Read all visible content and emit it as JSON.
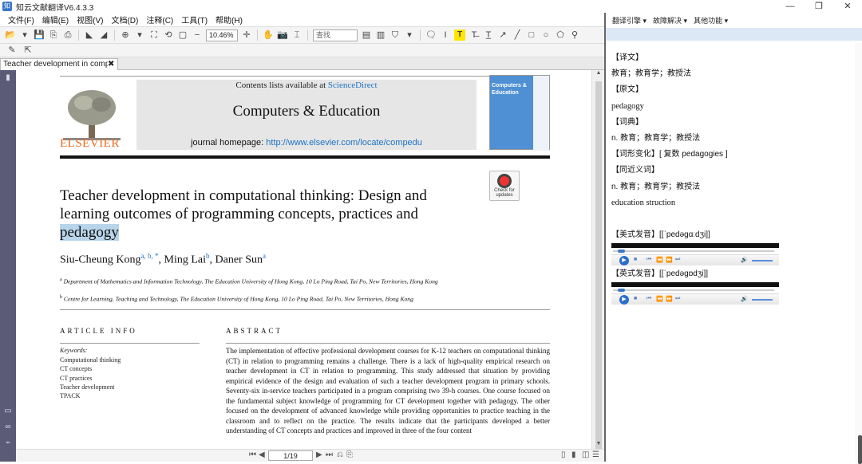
{
  "window": {
    "title": "知云文献翻译V6.4.3.3",
    "controls": [
      "—",
      "❐",
      "✕"
    ]
  },
  "menu": [
    "文件(F)",
    "编辑(E)",
    "视图(V)",
    "文档(D)",
    "注释(C)",
    "工具(T)",
    "帮助(H)"
  ],
  "toolbar": {
    "zoom_value": "10.46%",
    "find_placeholder": "查找"
  },
  "tab": {
    "label": "Teacher development in comp...",
    "close": "✖"
  },
  "doc": {
    "available": "Contents lists available at ",
    "sciencedirect": "ScienceDirect",
    "journal": "Computers & Education",
    "homepage_label": "journal homepage: ",
    "homepage_url": "http://www.elsevier.com/locate/compedu",
    "publisher": "ELSEVIER",
    "cover_title": "Computers & Education",
    "check_updates": "Check for updates",
    "title_part1": "Teacher development in computational thinking: Design and learning outcomes of programming concepts, practices and ",
    "title_highlight": "pedagogy",
    "author1": "Siu-Cheung Kong",
    "author1_sup": "a, b, *",
    "author2": ", Ming Lai",
    "author2_sup": "b",
    "author3": ", Daner Sun",
    "author3_sup": "a",
    "affil_a_sup": "a",
    "affil_a": "Department of Mathematics and Information Technology, The Education University of Hong Kong, 10 Lo Ping Road, Tai Po, New Territories, Hong Kong",
    "affil_b_sup": "b",
    "affil_b": "Centre for Learning, Teaching and Technology, The Education University of Hong Kong, 10 Lo Ping Road, Tai Po, New Territories, Hong Kong",
    "article_info_head": "ARTICLE INFO",
    "abstract_head": "ABSTRACT",
    "keywords_label": "Keywords:",
    "keywords": [
      "Computational thinking",
      "CT concepts",
      "CT practices",
      "Teacher development",
      "TPACK"
    ],
    "abstract": "The implementation of effective professional development courses for K-12 teachers on computational thinking (CT) in relation to programming remains a challenge. There is a lack of high-quality empirical research on teacher development in CT in relation to programming. This study addressed that situation by providing empirical evidence of the design and evaluation of such a teacher development program in primary schools. Seventy-six in-service teachers participated in a program comprising two 39-h courses. One course focused on the fundamental subject knowledge of programming for CT development together with pedagogy. The other focused on the development of advanced knowledge while providing opportunities to practice teaching in the classroom and to reflect on the practice. The results indicate that the participants developed a better understanding of CT concepts and practices and improved in three of the four content"
  },
  "pagination": {
    "current": "1/19"
  },
  "right_panel": {
    "menus": [
      "翻译引擎 ▾",
      "故障解决 ▾",
      "其他功能 ▾"
    ],
    "lines": [
      {
        "text": "【译文】",
        "en": false
      },
      {
        "text": "教育；教育学；教授法",
        "en": false
      },
      {
        "text": "【原文】",
        "en": false
      },
      {
        "text": "pedagogy",
        "en": true
      },
      {
        "text": "【词典】",
        "en": false
      },
      {
        "text": "n. 教育；教育学；教授法",
        "en": false
      },
      {
        "text": "【词形变化】[ 复数 pedagogies ]",
        "en": false
      },
      {
        "text": "【同近义词】",
        "en": false
      },
      {
        "text": "n. 教育；教育学；教授法",
        "en": false
      },
      {
        "text": "education  struction",
        "en": true
      }
    ],
    "us_pron": "【美式发音】[[ˈpedəɡɑːdʒi]]",
    "uk_pron": "【英式发音】[[ˈpedəɡɒdʒi]]"
  }
}
